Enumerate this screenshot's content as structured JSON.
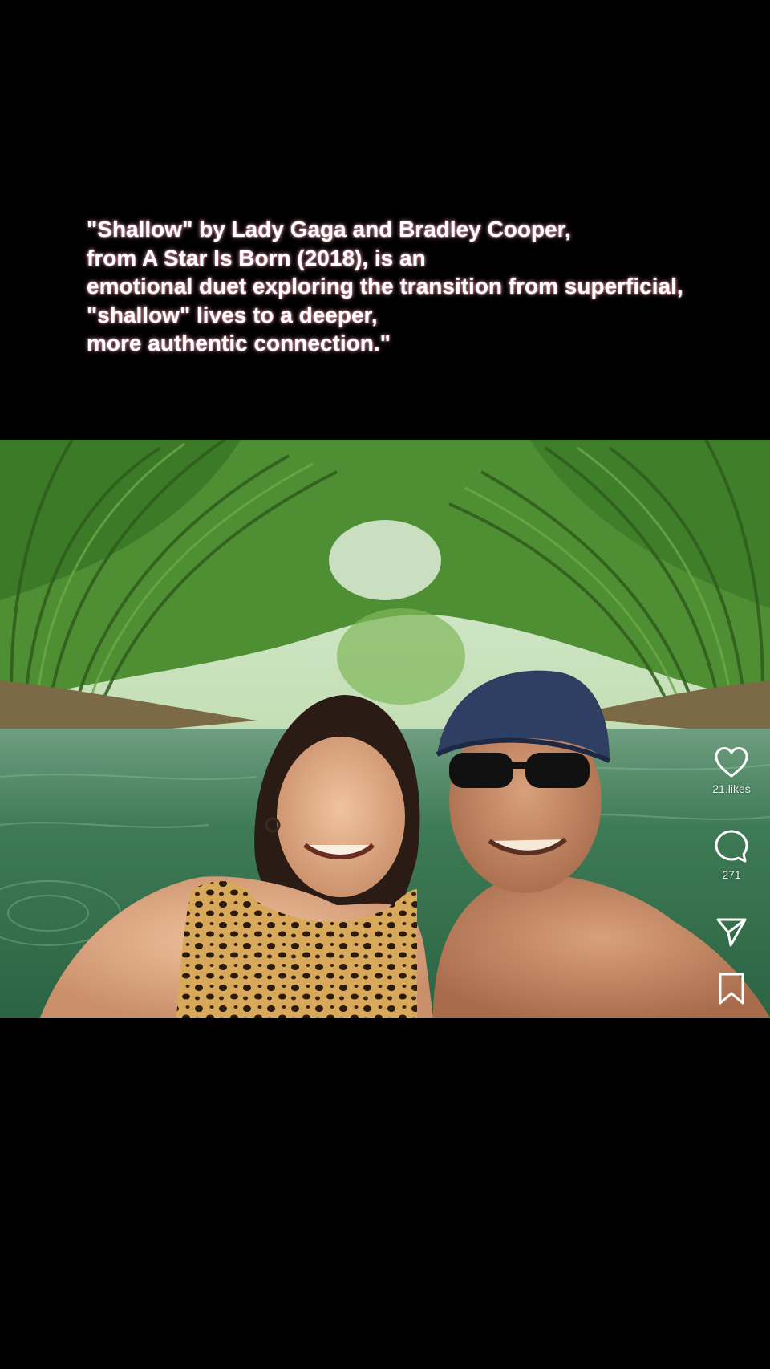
{
  "caption": {
    "lines": [
      "\"Shallow\" by Lady Gaga and Bradley Cooper,",
      "from A Star Is Born (2018), is an",
      "emotional duet exploring the transition from superficial,",
      "\"shallow\" lives to a deeper,",
      "more authentic connection.\""
    ],
    "glow_color": "#ffb4c8"
  },
  "actions": {
    "like": {
      "icon": "heart-icon",
      "count": "21.likes"
    },
    "comment": {
      "icon": "comment-bubble-icon",
      "count": "271"
    },
    "share": {
      "icon": "send-icon"
    },
    "save": {
      "icon": "bookmark-icon"
    }
  },
  "colors": {
    "background": "#000000",
    "foliage": "#3f7f2a",
    "water": "#3d7a52"
  }
}
